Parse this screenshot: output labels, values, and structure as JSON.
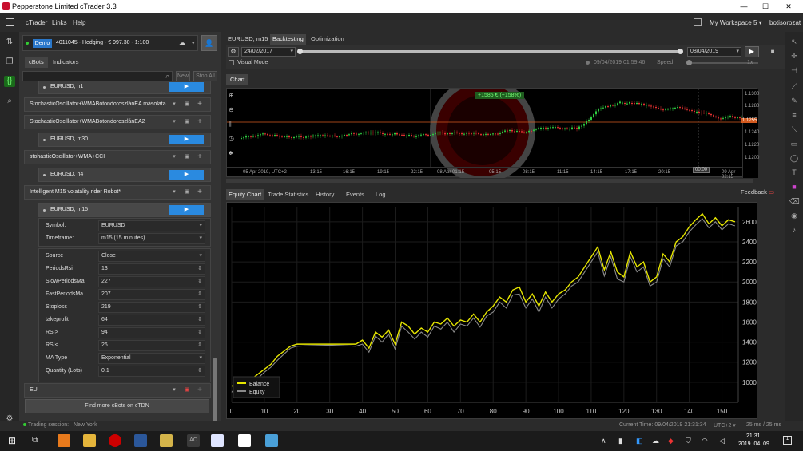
{
  "window": {
    "title": "Pepperstone Limited cTrader 3.3",
    "minimize": "—",
    "maximize": "☐",
    "close": "✕"
  },
  "menu": {
    "items": [
      "cTrader",
      "Links",
      "Help"
    ],
    "workspace": "My Workspace 5 ▾",
    "user": "botisorozat"
  },
  "account": {
    "badge": "Demo",
    "text": "4011045 - Hedging - € 997.30 - 1:100"
  },
  "left_tabs": [
    "cBots",
    "Indicators"
  ],
  "left_actions": {
    "new": "New",
    "stop_all": "Stop All"
  },
  "bots": [
    {
      "name": "EURUSD, h1",
      "instance": true,
      "partial": true
    },
    {
      "name": "StochasticOscillator+WMABotondoroszlánEA másolata"
    },
    {
      "name": "StochasticOscillator+WMABotondoroszlánEA2"
    },
    {
      "name": "EURUSD, m30",
      "instance": true
    },
    {
      "name": "stohasticOscillator+WMA+CCI"
    },
    {
      "name": "EURUSD, h4",
      "instance": true
    },
    {
      "name": "Intelligent M15 volatality rider Robot*"
    },
    {
      "name": "EURUSD, m15",
      "instance": true
    }
  ],
  "bot_settings": [
    {
      "label": "Symbol:",
      "value": "EURUSD"
    },
    {
      "label": "Timeframe:",
      "value": "m15 (15 minutes)"
    }
  ],
  "bot_params": [
    {
      "label": "Source",
      "value": "Close"
    },
    {
      "label": "PeriodsRsi",
      "value": "13"
    },
    {
      "label": "SlowPeriodsMa",
      "value": "227"
    },
    {
      "label": "FastPeriodsMa",
      "value": "207"
    },
    {
      "label": "Stoploss",
      "value": "219"
    },
    {
      "label": "takeprofit",
      "value": "64"
    },
    {
      "label": "RSI>",
      "value": "94"
    },
    {
      "label": "RSI<",
      "value": "26"
    },
    {
      "label": "MA Type",
      "value": "Exponential"
    },
    {
      "label": "Quantity (Lots)",
      "value": "0.1"
    }
  ],
  "eu_folder": "EU",
  "find_more": "Find more cBots on cTDN",
  "status": {
    "trading_session_label": "Trading session:",
    "trading_session": "New York",
    "current_time": "Current Time: 09/04/2019 21:31:34",
    "utc": "UTC+2 ▾",
    "speed": "25 ms / 25 ms"
  },
  "main_tabs": [
    "EURUSD, m15",
    "Backtesting",
    "Optimization"
  ],
  "backtest": {
    "start_date": "24/02/2017",
    "end_date": "08/04/2019",
    "visual_mode": "Visual Mode",
    "progress_time": "09/04/2019 01:59:46",
    "speed_label": "Speed",
    "speed_value": "1x",
    "progress": 1.0
  },
  "chart_tab": "Chart",
  "price_chart": {
    "badge": "+1585 € (+158%)",
    "price_labels": [
      "1.1300",
      "1.1280",
      "1.1260",
      "1.1240",
      "1.1220",
      "1.1200"
    ],
    "current_price": "1.1255",
    "time_labels": [
      "05 Apr 2019, UTC+2",
      "13:15",
      "16:15",
      "19:15",
      "22:15",
      "08 Apr 01:15",
      "05:15",
      "08:15",
      "11:15",
      "14:15",
      "17:15",
      "20:15",
      "23:15",
      "09 Apr 02:15"
    ],
    "cursor_time": "00:00"
  },
  "bottom_tabs": [
    "Equity Chart",
    "Trade Statistics",
    "History",
    "Events",
    "Log"
  ],
  "feedback": "Feedback",
  "taskbar": {
    "time": "21:31",
    "date": "2019. 04. 09."
  },
  "chart_data": {
    "type": "line",
    "title": "",
    "xlabel": "",
    "ylabel": "",
    "xlim": [
      0,
      155
    ],
    "ylim": [
      800,
      2750
    ],
    "x_ticks": [
      0,
      10,
      20,
      30,
      40,
      50,
      60,
      70,
      80,
      90,
      100,
      110,
      120,
      130,
      140,
      150
    ],
    "y_ticks": [
      1000,
      1200,
      1400,
      1600,
      1800,
      2000,
      2200,
      2400,
      2600
    ],
    "legend": "bottom-left",
    "series": [
      {
        "name": "Balance",
        "color": "#e6e600",
        "x": [
          0,
          2,
          4,
          6,
          8,
          10,
          12,
          14,
          16,
          18,
          20,
          30,
          38,
          40,
          42,
          44,
          46,
          48,
          50,
          52,
          54,
          56,
          58,
          60,
          62,
          64,
          66,
          68,
          70,
          72,
          74,
          76,
          78,
          80,
          82,
          84,
          86,
          88,
          90,
          92,
          94,
          96,
          98,
          100,
          102,
          104,
          106,
          108,
          110,
          112,
          114,
          116,
          118,
          120,
          122,
          124,
          126,
          128,
          130,
          132,
          134,
          136,
          138,
          140,
          142,
          144,
          146,
          148,
          150,
          152,
          154
        ],
        "values": [
          960,
          1010,
          900,
          1030,
          1080,
          1130,
          1180,
          1260,
          1310,
          1360,
          1380,
          1380,
          1380,
          1420,
          1340,
          1500,
          1450,
          1520,
          1380,
          1600,
          1560,
          1480,
          1540,
          1500,
          1600,
          1580,
          1640,
          1560,
          1620,
          1600,
          1680,
          1600,
          1700,
          1760,
          1850,
          1800,
          1920,
          1950,
          1800,
          1880,
          1760,
          1900,
          1800,
          1880,
          1920,
          2000,
          2050,
          2150,
          2250,
          2350,
          2120,
          2300,
          2100,
          2050,
          2300,
          2150,
          2200,
          2000,
          2050,
          2280,
          2200,
          2400,
          2450,
          2550,
          2620,
          2680,
          2580,
          2640,
          2560,
          2620,
          2600
        ]
      },
      {
        "name": "Equity",
        "color": "#8a8a8a",
        "x": [
          0,
          2,
          4,
          6,
          8,
          10,
          12,
          14,
          16,
          18,
          20,
          30,
          38,
          40,
          42,
          44,
          46,
          48,
          50,
          52,
          54,
          56,
          58,
          60,
          62,
          64,
          66,
          68,
          70,
          72,
          74,
          76,
          78,
          80,
          82,
          84,
          86,
          88,
          90,
          92,
          94,
          96,
          98,
          100,
          102,
          104,
          106,
          108,
          110,
          112,
          114,
          116,
          118,
          120,
          122,
          124,
          126,
          128,
          130,
          132,
          134,
          136,
          138,
          140,
          142,
          144,
          146,
          148,
          150,
          152,
          154
        ],
        "values": [
          900,
          980,
          860,
          990,
          1040,
          1100,
          1150,
          1220,
          1280,
          1340,
          1360,
          1370,
          1360,
          1380,
          1300,
          1460,
          1400,
          1480,
          1330,
          1560,
          1500,
          1430,
          1500,
          1450,
          1560,
          1530,
          1600,
          1500,
          1580,
          1560,
          1640,
          1550,
          1660,
          1700,
          1800,
          1740,
          1870,
          1880,
          1740,
          1830,
          1700,
          1850,
          1740,
          1830,
          1880,
          1960,
          2000,
          2100,
          2200,
          2300,
          2060,
          2250,
          2030,
          2000,
          2250,
          2100,
          2150,
          1960,
          2000,
          2230,
          2150,
          2360,
          2400,
          2500,
          2570,
          2630,
          2540,
          2600,
          2520,
          2580,
          2560
        ]
      }
    ]
  }
}
